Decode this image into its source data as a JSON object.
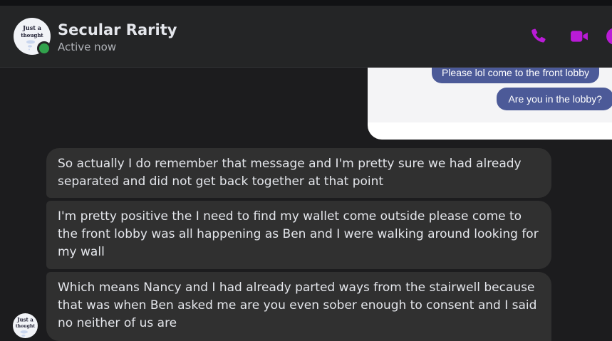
{
  "conversation": {
    "contact_name": "Secular Rarity",
    "status": "Active now",
    "avatar_text": "Just a thought",
    "icons": {
      "phone": "phone-icon",
      "video": "video-camera-icon",
      "info": "info-icon"
    },
    "accent_color": "#b91bd6"
  },
  "attachment": {
    "messages": [
      "Please lol come to the front lobby",
      "Are you in the lobby?"
    ]
  },
  "messages": [
    {
      "text": "So actually I do remember that message and I'm pretty sure we had already separated and did not get back together at that point"
    },
    {
      "text": "I'm pretty positive the I need to find my wallet come outside please come to the front lobby was all happening as Ben and I were walking around looking for my wall"
    },
    {
      "text": "Which means Nancy and I had already parted ways from the stairwell because that was when Ben asked me are you even sober enough to consent and I said no neither of us are"
    }
  ]
}
